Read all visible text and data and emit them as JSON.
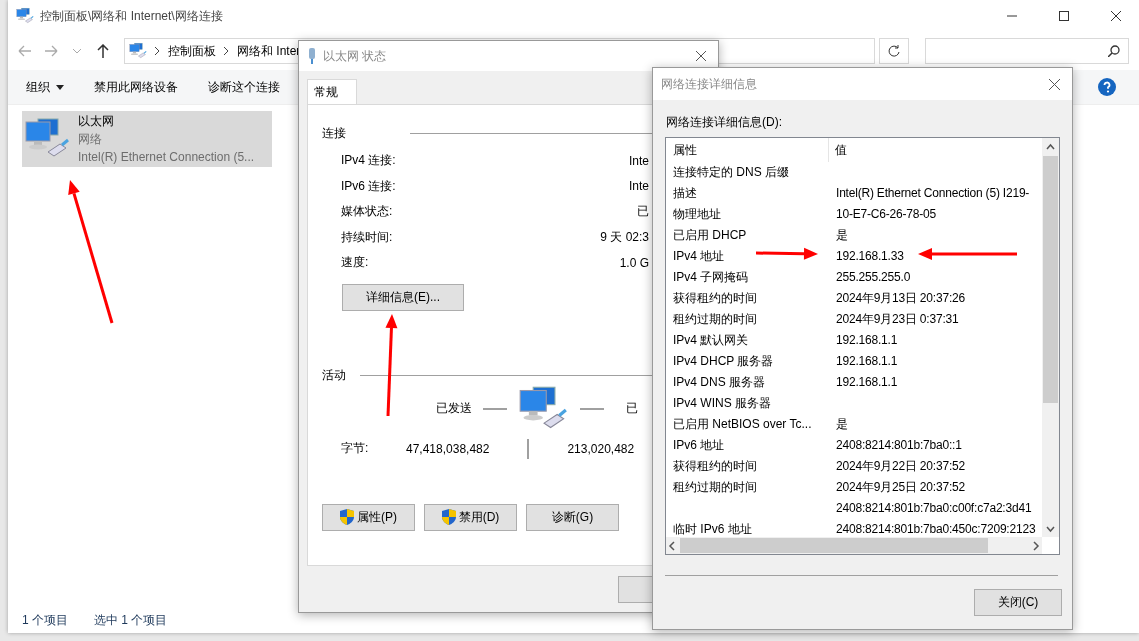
{
  "explorer": {
    "title": "控制面板\\网络和 Internet\\网络连接",
    "breadcrumb": [
      "控制面板",
      "网络和 Inter"
    ],
    "toolbar": [
      {
        "label": "组织",
        "kind": "menu"
      },
      {
        "label": "禁用此网络设备",
        "kind": "button"
      },
      {
        "label": "诊断这个连接",
        "kind": "button"
      }
    ],
    "items": [
      {
        "name": "以太网",
        "type": "网络",
        "device": "Intel(R) Ethernet Connection (5...",
        "selected": true
      }
    ],
    "status_bar": [
      "1 个项目",
      "选中 1 个项目"
    ]
  },
  "status_dialog": {
    "title": "以太网 状态",
    "tabs": [
      {
        "label": "常规",
        "selected": true
      }
    ],
    "connection_heading": "连接",
    "fields": [
      {
        "label": "IPv4 连接:",
        "value": "Inte"
      },
      {
        "label": "IPv6 连接:",
        "value": "Inte"
      },
      {
        "label": "媒体状态:",
        "value": "已"
      },
      {
        "label": "持续时间:",
        "value": "9 天 02:3"
      },
      {
        "label": "速度:",
        "value": "1.0 G"
      }
    ],
    "details_button": "详细信息(E)...",
    "activity_heading": "活动",
    "sent_label": "已发送",
    "received_label": "已",
    "bytes_label": "字节:",
    "bytes_sent": "47,418,038,482",
    "bytes_received": "213,020,482",
    "buttons": [
      {
        "label": "属性(P)",
        "shield": true
      },
      {
        "label": "禁用(D)",
        "shield": true
      },
      {
        "label": "诊断(G)",
        "shield": false
      }
    ]
  },
  "details_dialog": {
    "title": "网络连接详细信息",
    "list_label": "网络连接详细信息(D):",
    "columns": [
      "属性",
      "值"
    ],
    "rows": [
      {
        "property": "连接特定的 DNS 后缀"
      },
      {
        "property": "描述",
        "value": "Intel(R) Ethernet Connection (5) I219-"
      },
      {
        "property": "物理地址",
        "value": "10-E7-C6-26-78-05"
      },
      {
        "property": "已启用 DHCP",
        "value": "是"
      },
      {
        "property": "IPv4 地址",
        "value": "192.168.1.33"
      },
      {
        "property": "IPv4 子网掩码",
        "value": "255.255.255.0"
      },
      {
        "property": "获得租约的时间",
        "value": "2024年9月13日 20:37:26"
      },
      {
        "property": "租约过期的时间",
        "value": "2024年9月23日 0:37:31"
      },
      {
        "property": "IPv4 默认网关",
        "value": "192.168.1.1"
      },
      {
        "property": "IPv4 DHCP 服务器",
        "value": "192.168.1.1"
      },
      {
        "property": "IPv4 DNS 服务器",
        "value": "192.168.1.1"
      },
      {
        "property": "IPv4 WINS 服务器"
      },
      {
        "property": "已启用 NetBIOS over Tc...",
        "value": "是"
      },
      {
        "property": "IPv6 地址",
        "value": "2408:8214:801b:7ba0::1"
      },
      {
        "property": "获得租约的时间",
        "value": "2024年9月22日 20:37:52"
      },
      {
        "property": "租约过期的时间",
        "value": "2024年9月25日 20:37:52"
      },
      {
        "value": "2408:8214:801b:7ba0:c00f:c7a2:3d41"
      },
      {
        "property": "临时 IPv6 地址",
        "value": "2408:8214:801b:7ba0:450c:7209:2123"
      }
    ],
    "close_button": "关闭(C)"
  }
}
